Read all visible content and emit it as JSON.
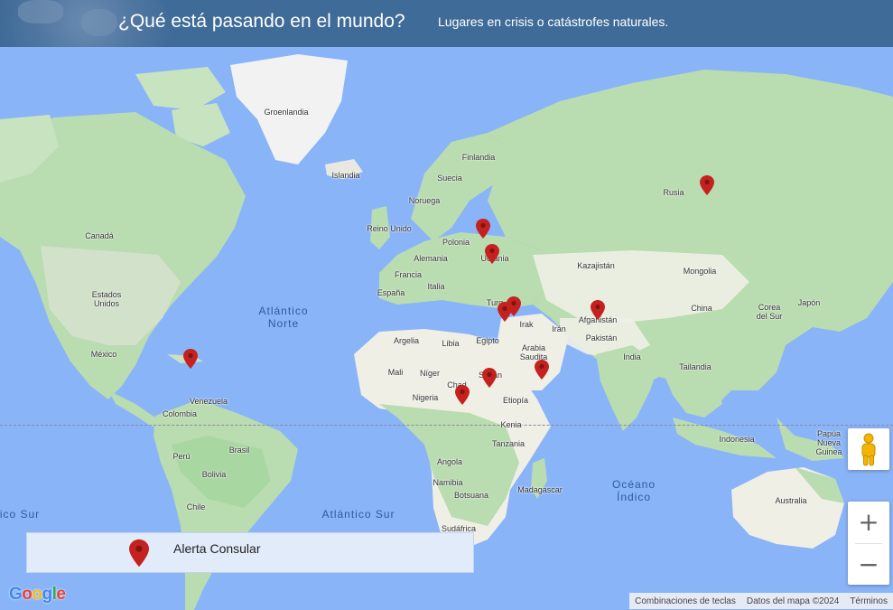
{
  "header": {
    "title": "¿Qué está pasando en el mundo?",
    "subtitle": "Lugares en crisis o catástrofes naturales."
  },
  "map": {
    "labels": {
      "groenlandia": "Groenlandia",
      "islandia": "Islandia",
      "finlandia": "Finlandia",
      "suecia": "Suecia",
      "noruega": "Noruega",
      "reino_unido": "Reino Unido",
      "polonia": "Polonia",
      "alemania": "Alemania",
      "ucrania": "Ucrania",
      "francia": "Francia",
      "italia": "Italia",
      "espana": "España",
      "kazajistan": "Kazajistán",
      "mongolia": "Mongolia",
      "rusia": "Rusia",
      "china": "China",
      "corea_del_sur": "Corea\ndel Sur",
      "japon": "Japón",
      "turquia": "Turq",
      "irak": "Irak",
      "iran": "Irán",
      "afganistan": "Afganistán",
      "pakistan": "Pakistán",
      "india": "India",
      "tailandia": "Tailandia",
      "arabia_saudita": "Arabia\nSaudita",
      "argelia": "Argelia",
      "libia": "Libia",
      "egipto": "Egipto",
      "mali": "Mali",
      "niger": "Níger",
      "chad": "Chad",
      "sudan": "Sudán",
      "nigeria": "Nigeria",
      "etiopia": "Etiopía",
      "kenia": "Kenia",
      "tanzania": "Tanzania",
      "angola": "Angola",
      "namibia": "Namibia",
      "botsuana": "Botsuana",
      "madagascar": "Madagascar",
      "sudafrica": "Sudáfrica",
      "canada": "Canadá",
      "estados_unidos": "Estados\nUnidos",
      "mexico": "México",
      "venezuela": "Venezuela",
      "colombia": "Colombia",
      "peru": "Perú",
      "brasil": "Brasil",
      "bolivia": "Bolivia",
      "chile": "Chile",
      "indonesia": "Indonesia",
      "papua": "Papúa\nNueva\nGuinea",
      "australia": "Australia"
    },
    "oceans": {
      "atlantico_norte": "Atlántico\nNorte",
      "atlantico_sur": "Atlántico Sur",
      "oceano_indico": "Océano\nÍndico",
      "pacifico_sur": "ico Sur"
    },
    "marker_color": "#c5221f",
    "markers": [
      "Rusia",
      "Polonia",
      "Ucrania",
      "Turquía",
      "Siria",
      "Afganistán",
      "Yemen",
      "Sudán",
      "Chad",
      "Haití"
    ]
  },
  "legend": {
    "label": "Alerta Consular",
    "icon": "map-pin-icon"
  },
  "controls": {
    "zoom_in": "+",
    "zoom_out": "−",
    "pegman_icon": "street-view-pegman-icon"
  },
  "attribution": {
    "logo": "Google",
    "shortcuts": "Combinaciones de teclas",
    "map_data": "Datos del mapa ©2024",
    "terms": "Términos"
  }
}
